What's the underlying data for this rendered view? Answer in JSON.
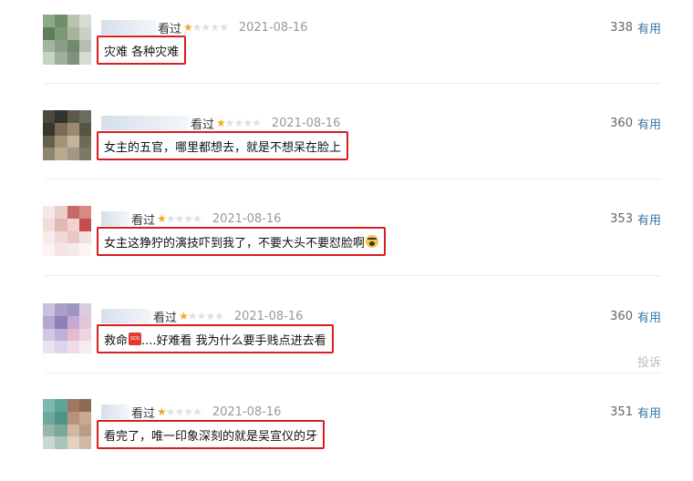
{
  "comments": [
    {
      "status": "看过",
      "rating": 1,
      "date": "2021-08-16",
      "useful_count": "338",
      "useful_label": "有用",
      "text": "灾难 各种灾难",
      "emoji": null,
      "avatar_colors": [
        "#8ea88a",
        "#6e8f6a",
        "#b9c4b0",
        "#d8ddd4",
        "#5f7d5a",
        "#7c9a78",
        "#a7b59f",
        "#c9cfc5",
        "#a3b7a0",
        "#8a9f86",
        "#6f8b6c",
        "#b5c1b0",
        "#c8d2c5",
        "#9fb09b",
        "#7f927c",
        "#d6dcd2"
      ],
      "report_label": null
    },
    {
      "status": "看过",
      "rating": 1,
      "date": "2021-08-16",
      "useful_count": "360",
      "useful_label": "有用",
      "text": "女主的五官，哪里都想去，就是不想呆在脸上",
      "emoji": null,
      "avatar_colors": [
        "#4a4a3e",
        "#2f3329",
        "#5b5a4a",
        "#6b6c5c",
        "#36382f",
        "#7b6a55",
        "#9c8a70",
        "#575446",
        "#64604e",
        "#a49377",
        "#c2b49a",
        "#6e6a58",
        "#8a8670",
        "#b7aa90",
        "#a09a82",
        "#7a7866"
      ],
      "report_label": null
    },
    {
      "status": "看过",
      "rating": 1,
      "date": "2021-08-16",
      "useful_count": "353",
      "useful_label": "有用",
      "text": "女主这狰狞的演技吓到我了，不要大头不要怼脸啊",
      "emoji": "scared-face",
      "avatar_colors": [
        "#f4e8e6",
        "#e8cfcc",
        "#c76a6a",
        "#d98a86",
        "#f2dcd9",
        "#e3b7b2",
        "#f0d2ce",
        "#c74c4f",
        "#f7ecea",
        "#efd9d6",
        "#e9c8c4",
        "#f4e2df",
        "#faf3f2",
        "#f3e5e3",
        "#f6eae8",
        "#fbf5f4"
      ],
      "report_label": null
    },
    {
      "status": "看过",
      "rating": 1,
      "date": "2021-08-16",
      "useful_count": "360",
      "useful_label": "有用",
      "text_before": "救命",
      "text_after": "....好难看 我为什么要手贱点进去看",
      "emoji": "sos",
      "avatar_colors": [
        "#c9c2dd",
        "#a99fc9",
        "#9f94c2",
        "#d9cbe0",
        "#b4a8d0",
        "#8f7fb8",
        "#c4aad0",
        "#e3c5d8",
        "#d4c7e2",
        "#bfb0d6",
        "#e6b9cf",
        "#ecd5e2",
        "#e9e2f0",
        "#ded3e8",
        "#f0dce6",
        "#f5ecf2"
      ],
      "report_label": "投诉"
    },
    {
      "status": "看过",
      "rating": 1,
      "date": "2021-08-16",
      "useful_count": "351",
      "useful_label": "有用",
      "text": "看完了，唯一印象深刻的就是吴宣仪的牙",
      "emoji": null,
      "avatar_colors": [
        "#7fb9ad",
        "#5fa597",
        "#a0785f",
        "#8c6a55",
        "#6aa99c",
        "#4f9487",
        "#b49378",
        "#c7a98e",
        "#93b7ad",
        "#7aa89c",
        "#d2b8a0",
        "#b89d85",
        "#c9d8d2",
        "#a8c4bb",
        "#e2d1c0",
        "#cdb9a6"
      ],
      "report_label": null
    }
  ]
}
